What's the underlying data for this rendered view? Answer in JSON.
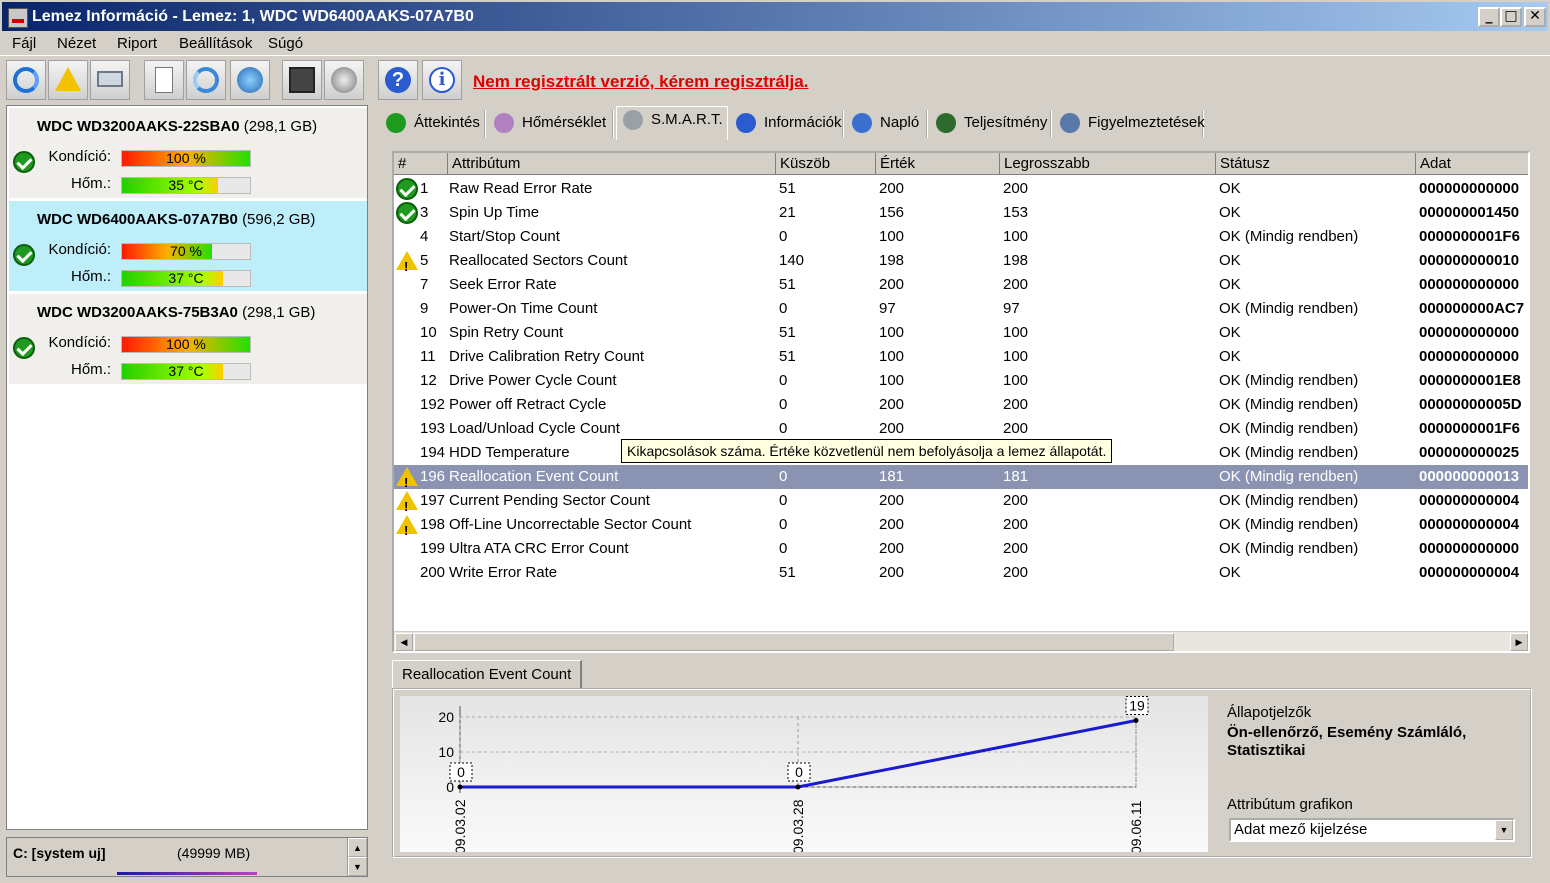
{
  "window": {
    "title": "Lemez Információ - Lemez: 1, WDC WD6400AAKS-07A7B0",
    "min": "_",
    "max": "□",
    "close": "✕"
  },
  "menu": [
    "Fájl",
    "Nézet",
    "Riport",
    "Beállítások",
    "Súgó"
  ],
  "toolbar": {
    "icons": [
      "refresh-icon",
      "warning-icon",
      "disk-icon",
      "document-icon",
      "sync-icon",
      "network-icon",
      "screen-icon",
      "speaker-icon",
      "help-icon",
      "info-icon"
    ],
    "help_glyph": "?",
    "info_glyph": "i",
    "register_link": "Nem regisztrált verzió, kérem regisztrálja."
  },
  "disks": [
    {
      "name": "WDC WD3200AAKS-22SBA0",
      "size": "(298,1 GB)",
      "condition_label": "Kondíció:",
      "condition": "100 %",
      "condition_pct": 100,
      "temp_label": "Hőm.:",
      "temp": "35 °C",
      "temp_pct": 75,
      "selected": false
    },
    {
      "name": "WDC WD6400AAKS-07A7B0",
      "size": "(596,2 GB)",
      "condition_label": "Kondíció:",
      "condition": "70 %",
      "condition_pct": 70,
      "temp_label": "Hőm.:",
      "temp": "37 °C",
      "temp_pct": 79,
      "selected": true
    },
    {
      "name": "WDC WD3200AAKS-75B3A0",
      "size": "(298,1 GB)",
      "condition_label": "Kondíció:",
      "condition": "100 %",
      "condition_pct": 100,
      "temp_label": "Hőm.:",
      "temp": "37 °C",
      "temp_pct": 79,
      "selected": false
    }
  ],
  "partition": {
    "label": "C: [system uj]",
    "size": "(49999 MB)"
  },
  "tabs": [
    {
      "label": "Áttekintés",
      "icon": "check-icon",
      "active": false
    },
    {
      "label": "Hőmérséklet",
      "icon": "thermometer-icon",
      "active": false
    },
    {
      "label": "S.M.A.R.T.",
      "icon": "smart-disk-icon",
      "active": true
    },
    {
      "label": "Információk",
      "icon": "info-icon",
      "active": false
    },
    {
      "label": "Napló",
      "icon": "log-icon",
      "active": false
    },
    {
      "label": "Teljesítmény",
      "icon": "gauge-icon",
      "active": false
    },
    {
      "label": "Figyelmeztetések",
      "icon": "alerts-icon",
      "active": false
    }
  ],
  "table": {
    "headers": [
      "#",
      "Attribútum",
      "Küszöb",
      "Érték",
      "Legrosszabb",
      "Státusz",
      "Adat"
    ],
    "rows": [
      {
        "status_icon": "ok",
        "id": "1",
        "attr": "Raw Read Error Rate",
        "thr": "51",
        "val": "200",
        "worst": "200",
        "status": "OK",
        "data": "000000000000"
      },
      {
        "status_icon": "ok",
        "id": "3",
        "attr": "Spin Up Time",
        "thr": "21",
        "val": "156",
        "worst": "153",
        "status": "OK",
        "data": "000000001450"
      },
      {
        "status_icon": "",
        "id": "4",
        "attr": "Start/Stop Count",
        "thr": "0",
        "val": "100",
        "worst": "100",
        "status": "OK (Mindig rendben)",
        "data": "0000000001F6"
      },
      {
        "status_icon": "warn",
        "id": "5",
        "attr": "Reallocated Sectors Count",
        "thr": "140",
        "val": "198",
        "worst": "198",
        "status": "OK",
        "data": "000000000010"
      },
      {
        "status_icon": "",
        "id": "7",
        "attr": "Seek Error Rate",
        "thr": "51",
        "val": "200",
        "worst": "200",
        "status": "OK",
        "data": "000000000000"
      },
      {
        "status_icon": "",
        "id": "9",
        "attr": "Power-On Time Count",
        "thr": "0",
        "val": "97",
        "worst": "97",
        "status": "OK (Mindig rendben)",
        "data": "000000000AC7"
      },
      {
        "status_icon": "",
        "id": "10",
        "attr": "Spin Retry Count",
        "thr": "51",
        "val": "100",
        "worst": "100",
        "status": "OK",
        "data": "000000000000"
      },
      {
        "status_icon": "",
        "id": "11",
        "attr": "Drive Calibration Retry Count",
        "thr": "51",
        "val": "100",
        "worst": "100",
        "status": "OK",
        "data": "000000000000"
      },
      {
        "status_icon": "",
        "id": "12",
        "attr": "Drive Power Cycle Count",
        "thr": "0",
        "val": "100",
        "worst": "100",
        "status": "OK (Mindig rendben)",
        "data": "0000000001E8"
      },
      {
        "status_icon": "",
        "id": "192",
        "attr": "Power off Retract Cycle",
        "thr": "0",
        "val": "200",
        "worst": "200",
        "status": "OK (Mindig rendben)",
        "data": "00000000005D"
      },
      {
        "status_icon": "",
        "id": "193",
        "attr": "Load/Unload Cycle Count",
        "thr": "0",
        "val": "200",
        "worst": "200",
        "status": "OK (Mindig rendben)",
        "data": "0000000001F6"
      },
      {
        "status_icon": "",
        "id": "194",
        "attr": "HDD Temperature",
        "thr": "",
        "val": "",
        "worst": "",
        "status": "OK (Mindig rendben)",
        "data": "000000000025"
      },
      {
        "status_icon": "warn",
        "id": "196",
        "attr": "Reallocation Event Count",
        "thr": "0",
        "val": "181",
        "worst": "181",
        "status": "OK (Mindig rendben)",
        "data": "000000000013",
        "selected": true
      },
      {
        "status_icon": "warn",
        "id": "197",
        "attr": "Current Pending Sector Count",
        "thr": "0",
        "val": "200",
        "worst": "200",
        "status": "OK (Mindig rendben)",
        "data": "000000000004"
      },
      {
        "status_icon": "warn",
        "id": "198",
        "attr": "Off-Line Uncorrectable Sector Count",
        "thr": "0",
        "val": "200",
        "worst": "200",
        "status": "OK (Mindig rendben)",
        "data": "000000000004"
      },
      {
        "status_icon": "",
        "id": "199",
        "attr": "Ultra ATA CRC Error Count",
        "thr": "0",
        "val": "200",
        "worst": "200",
        "status": "OK (Mindig rendben)",
        "data": "000000000000"
      },
      {
        "status_icon": "",
        "id": "200",
        "attr": "Write Error Rate",
        "thr": "51",
        "val": "200",
        "worst": "200",
        "status": "OK",
        "data": "000000000004"
      }
    ]
  },
  "tooltip": "Kikapcsolások száma. Értéke közvetlenül nem befolyásolja a lemez állapotát.",
  "chart_panel": {
    "tab": "Reallocation Event Count",
    "side_title": "Állapotjelzők",
    "side_value": "Ön-ellenőrző, Esemény Számláló, Statisztikai",
    "graph_label": "Attribútum grafikon",
    "graph_select": "Adat mező kijelzése"
  },
  "chart_data": {
    "type": "line",
    "x": [
      "09.03.02",
      "09.03.28",
      "09.06.11"
    ],
    "values": [
      0,
      0,
      19
    ],
    "data_labels": [
      "0",
      "0",
      "19"
    ],
    "yticks": [
      "20",
      "10",
      "0"
    ],
    "ylim": [
      0,
      20
    ],
    "colors": {
      "line": "#1a1ad0"
    }
  }
}
